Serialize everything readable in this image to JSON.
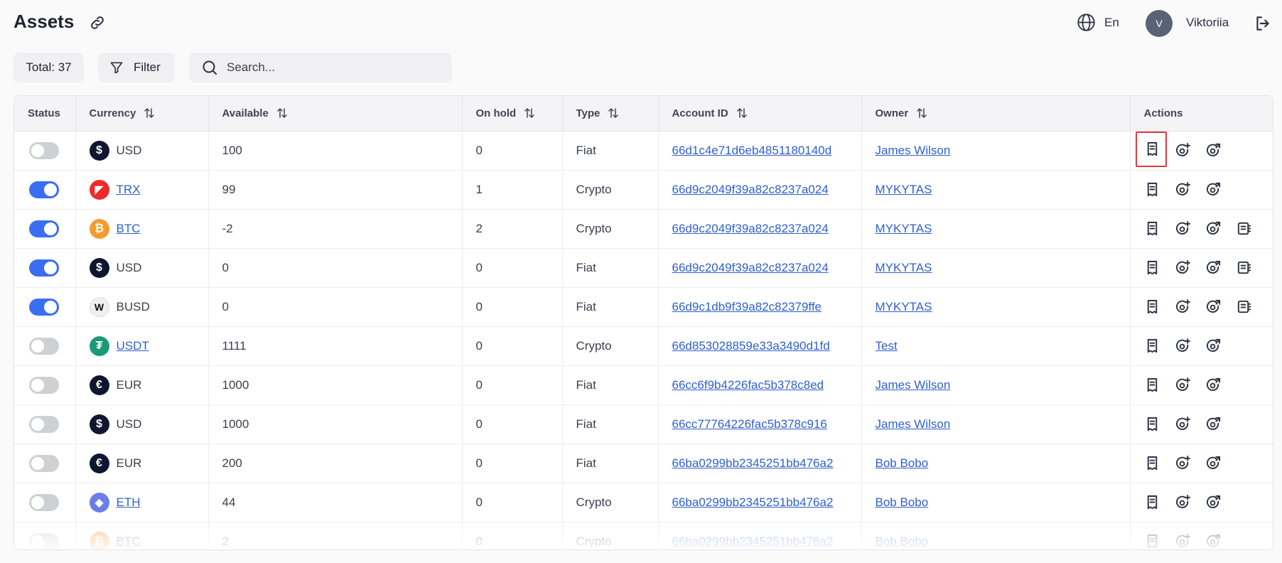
{
  "header": {
    "title": "Assets",
    "language": "En",
    "user_initial": "V",
    "user_name": "Viktoriia"
  },
  "toolbar": {
    "total_label": "Total: 37",
    "filter_label": "Filter",
    "search_placeholder": "Search..."
  },
  "table": {
    "columns": {
      "status": "Status",
      "currency": "Currency",
      "available": "Available",
      "on_hold": "On hold",
      "type": "Type",
      "account_id": "Account ID",
      "owner": "Owner",
      "actions": "Actions"
    },
    "rows": [
      {
        "enabled": false,
        "currency": "USD",
        "coin": "usd",
        "currency_link": false,
        "available": "100",
        "on_hold": "0",
        "type": "Fiat",
        "account_id": "66d1c4e71d6eb4851180140d",
        "owner": "James Wilson",
        "action_count": 3
      },
      {
        "enabled": true,
        "currency": "TRX",
        "coin": "trx",
        "currency_link": true,
        "available": "99",
        "on_hold": "1",
        "type": "Crypto",
        "account_id": "66d9c2049f39a82c8237a024",
        "owner": "MYKYTAS",
        "action_count": 3
      },
      {
        "enabled": true,
        "currency": "BTC",
        "coin": "btc",
        "currency_link": true,
        "available": "-2",
        "on_hold": "2",
        "type": "Crypto",
        "account_id": "66d9c2049f39a82c8237a024",
        "owner": "MYKYTAS",
        "action_count": 4
      },
      {
        "enabled": true,
        "currency": "USD",
        "coin": "usd",
        "currency_link": false,
        "available": "0",
        "on_hold": "0",
        "type": "Fiat",
        "account_id": "66d9c2049f39a82c8237a024",
        "owner": "MYKYTAS",
        "action_count": 4
      },
      {
        "enabled": true,
        "currency": "BUSD",
        "coin": "busd",
        "currency_link": false,
        "available": "0",
        "on_hold": "0",
        "type": "Fiat",
        "account_id": "66d9c1db9f39a82c82379ffe",
        "owner": "MYKYTAS",
        "action_count": 4
      },
      {
        "enabled": false,
        "currency": "USDT",
        "coin": "usdt",
        "currency_link": true,
        "available": "1111",
        "on_hold": "0",
        "type": "Crypto",
        "account_id": "66d853028859e33a3490d1fd",
        "owner": "Test",
        "action_count": 3
      },
      {
        "enabled": false,
        "currency": "EUR",
        "coin": "eur",
        "currency_link": false,
        "available": "1000",
        "on_hold": "0",
        "type": "Fiat",
        "account_id": "66cc6f9b4226fac5b378c8ed",
        "owner": "James Wilson",
        "action_count": 3
      },
      {
        "enabled": false,
        "currency": "USD",
        "coin": "usd",
        "currency_link": false,
        "available": "1000",
        "on_hold": "0",
        "type": "Fiat",
        "account_id": "66cc77764226fac5b378c916",
        "owner": "James Wilson",
        "action_count": 3
      },
      {
        "enabled": false,
        "currency": "EUR",
        "coin": "eur",
        "currency_link": false,
        "available": "200",
        "on_hold": "0",
        "type": "Fiat",
        "account_id": "66ba0299bb2345251bb476a2",
        "owner": "Bob Bobo",
        "action_count": 3
      },
      {
        "enabled": false,
        "currency": "ETH",
        "coin": "eth",
        "currency_link": true,
        "available": "44",
        "on_hold": "0",
        "type": "Crypto",
        "account_id": "66ba0299bb2345251bb476a2",
        "owner": "Bob Bobo",
        "action_count": 3
      },
      {
        "enabled": false,
        "currency": "BTC",
        "coin": "btc",
        "currency_link": true,
        "available": "2",
        "on_hold": "0",
        "type": "Crypto",
        "account_id": "66ba0299bb2345251bb476a2",
        "owner": "Bob Bobo",
        "action_count": 3
      }
    ]
  },
  "icons": {
    "link": "link-icon",
    "globe": "globe-icon",
    "logout": "logout-icon",
    "filter": "filter-icon",
    "search": "search-icon",
    "sort": "sort-arrows-icon",
    "receipt": "receipt-icon",
    "coin_add": "coin-add-icon",
    "coin_out": "coin-send-icon",
    "ledger": "ledger-icon"
  },
  "colors": {
    "accent": "#3a6ef2",
    "link": "#2f5fd0",
    "highlight": "#e0393b"
  }
}
